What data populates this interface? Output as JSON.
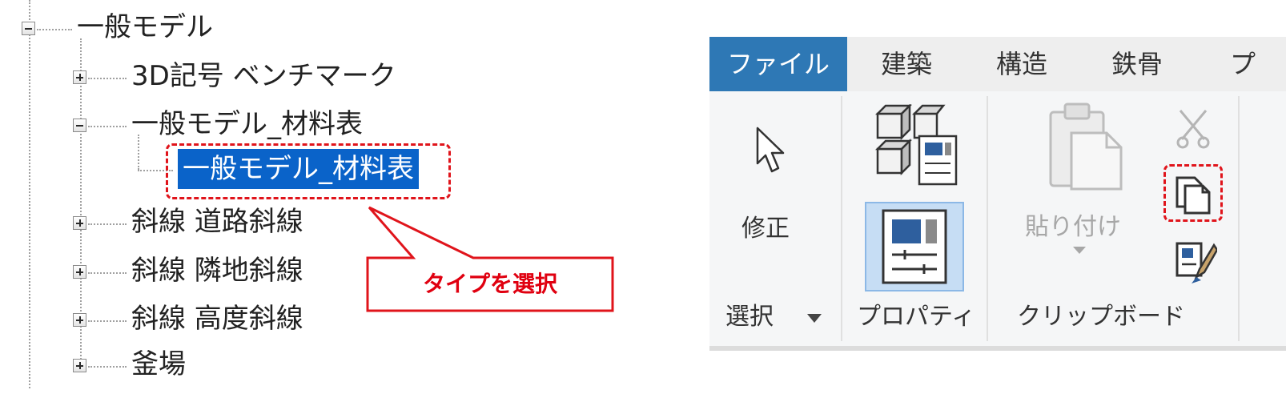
{
  "tree": {
    "root": {
      "label": "一般モデル",
      "expanded": true
    },
    "children": [
      {
        "label": "3D記号 ベンチマーク",
        "expanded": false
      },
      {
        "label": "一般モデル_材料表",
        "expanded": true,
        "children": [
          {
            "label": "一般モデル_材料表",
            "selected": true
          }
        ]
      },
      {
        "label": "斜線 道路斜線",
        "expanded": false
      },
      {
        "label": "斜線 隣地斜線",
        "expanded": false
      },
      {
        "label": "斜線 高度斜線",
        "expanded": false
      },
      {
        "label": "釜場",
        "expanded": false
      }
    ]
  },
  "callout": {
    "text": "タイプを選択",
    "color": "#e00010"
  },
  "ribbon": {
    "tabs": [
      "ファイル",
      "建築",
      "構造",
      "鉄骨",
      "プ"
    ],
    "active_tab": "ファイル",
    "panels": {
      "select": {
        "title": "選択",
        "buttons": {
          "modify": "修正"
        }
      },
      "properties": {
        "title": "プロパティ"
      },
      "clipboard": {
        "title": "クリップボード",
        "buttons": {
          "paste": "貼り付け"
        }
      }
    },
    "colors": {
      "active_tab": "#2e78b5",
      "selection": "#0a63c9",
      "highlight": "#e0141b"
    }
  }
}
